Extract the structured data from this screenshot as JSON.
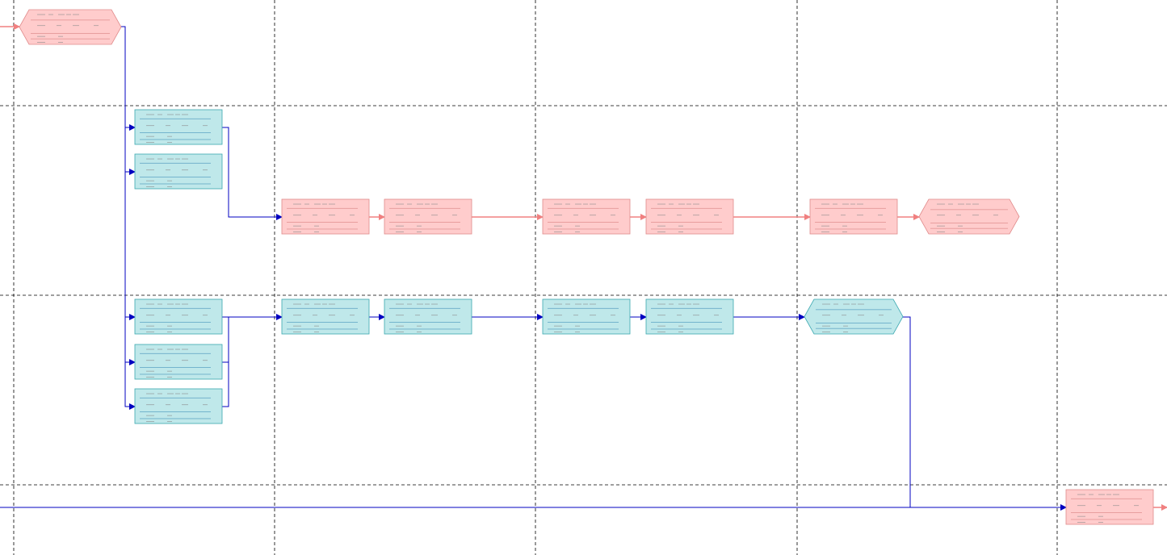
{
  "colors": {
    "background": "#ffffff",
    "grid_line": "#000000",
    "critical_fill": "#ffcccc",
    "critical_stroke": "#e08a8a",
    "critical_arrow": "#f08080",
    "normal_fill": "#bfe8ea",
    "normal_stroke": "#3aa8b0",
    "normal_arrow": "#0000c0",
    "row_line_critical": "#d07070",
    "row_line_normal": "#2b7fb0"
  },
  "diagram": {
    "type": "network-diagram",
    "node_count": 19,
    "nodes": [
      {
        "id": "n01",
        "kind": "critical",
        "shape": "hexagon"
      },
      {
        "id": "n02",
        "kind": "normal",
        "shape": "box"
      },
      {
        "id": "n03",
        "kind": "normal",
        "shape": "box"
      },
      {
        "id": "n04",
        "kind": "critical",
        "shape": "box"
      },
      {
        "id": "n05",
        "kind": "critical",
        "shape": "box"
      },
      {
        "id": "n06",
        "kind": "critical",
        "shape": "box"
      },
      {
        "id": "n07",
        "kind": "critical",
        "shape": "box"
      },
      {
        "id": "n08",
        "kind": "critical",
        "shape": "box"
      },
      {
        "id": "n09",
        "kind": "critical",
        "shape": "hexagon"
      },
      {
        "id": "n10",
        "kind": "normal",
        "shape": "box"
      },
      {
        "id": "n11",
        "kind": "normal",
        "shape": "box"
      },
      {
        "id": "n12",
        "kind": "normal",
        "shape": "box"
      },
      {
        "id": "n13",
        "kind": "normal",
        "shape": "box"
      },
      {
        "id": "n14",
        "kind": "normal",
        "shape": "box"
      },
      {
        "id": "n15",
        "kind": "normal",
        "shape": "box"
      },
      {
        "id": "n16",
        "kind": "normal",
        "shape": "hexagon"
      },
      {
        "id": "n17",
        "kind": "normal",
        "shape": "box"
      },
      {
        "id": "n18",
        "kind": "normal",
        "shape": "box"
      },
      {
        "id": "n19",
        "kind": "critical",
        "shape": "box"
      }
    ],
    "edges": [
      {
        "from": "n01",
        "to": "n02",
        "kind": "normal"
      },
      {
        "from": "n01",
        "to": "n03",
        "kind": "normal"
      },
      {
        "from": "n01",
        "to": "n10",
        "kind": "normal"
      },
      {
        "from": "n01",
        "to": "n17",
        "kind": "normal"
      },
      {
        "from": "n01",
        "to": "n18",
        "kind": "normal"
      },
      {
        "from": "n02",
        "to": "n04",
        "kind": "normal"
      },
      {
        "from": "n04",
        "to": "n05",
        "kind": "critical"
      },
      {
        "from": "n05",
        "to": "n06",
        "kind": "critical"
      },
      {
        "from": "n06",
        "to": "n07",
        "kind": "critical"
      },
      {
        "from": "n07",
        "to": "n08",
        "kind": "critical"
      },
      {
        "from": "n08",
        "to": "n09",
        "kind": "critical"
      },
      {
        "from": "n10",
        "to": "n11",
        "kind": "normal"
      },
      {
        "from": "n17",
        "to": "n11",
        "kind": "normal"
      },
      {
        "from": "n18",
        "to": "n11",
        "kind": "normal"
      },
      {
        "from": "n11",
        "to": "n12",
        "kind": "normal"
      },
      {
        "from": "n12",
        "to": "n13",
        "kind": "normal"
      },
      {
        "from": "n13",
        "to": "n14",
        "kind": "normal"
      },
      {
        "from": "n14",
        "to": "n16",
        "kind": "normal"
      },
      {
        "from": "n16",
        "to": "n19",
        "kind": "normal"
      }
    ]
  }
}
